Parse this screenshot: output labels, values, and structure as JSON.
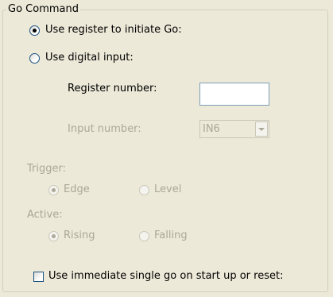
{
  "group": {
    "title": "Go Command"
  },
  "go_source": {
    "options": [
      {
        "label": "Use register to initiate Go:",
        "selected": true,
        "enabled": true
      },
      {
        "label": "Use digital input:",
        "selected": false,
        "enabled": true
      }
    ]
  },
  "register": {
    "label": "Register number:",
    "value": ""
  },
  "input": {
    "label": "Input number:",
    "value": "IN6",
    "enabled": false
  },
  "trigger": {
    "label": "Trigger:",
    "options": [
      {
        "label": "Edge",
        "selected": true,
        "enabled": false
      },
      {
        "label": "Level",
        "selected": false,
        "enabled": false
      }
    ]
  },
  "active": {
    "label": "Active:",
    "options": [
      {
        "label": "Rising",
        "selected": true,
        "enabled": false
      },
      {
        "label": "Falling",
        "selected": false,
        "enabled": false
      }
    ]
  },
  "immediate_go": {
    "label": "Use immediate single go on start up or reset:",
    "checked": false
  }
}
